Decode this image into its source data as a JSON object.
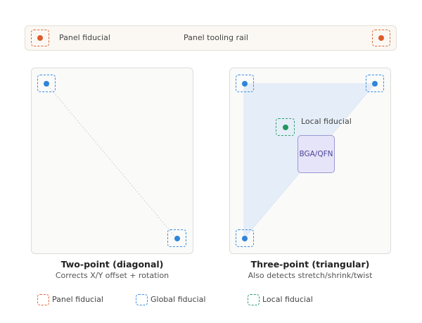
{
  "rail": {
    "left_label": "Panel fiducial",
    "center_label": "Panel tooling rail"
  },
  "two_point": {
    "title": "Two-point (diagonal)",
    "subtitle": "Corrects X/Y offset + rotation"
  },
  "three_point": {
    "title": "Three-point (triangular)",
    "subtitle": "Also detects stretch/shrink/twist",
    "local_label": "Local fiducial",
    "chip_label": "BGA/QFN"
  },
  "legend": {
    "panel": "Panel fiducial",
    "global": "Global fiducial",
    "local": "Local fiducial"
  },
  "colors": {
    "panel_fiducial": "#e05a2b",
    "global_fiducial": "#2f86d8",
    "local_fiducial": "#229661",
    "chip_fill": "#e6e4f8",
    "triangle_fill": "#e5eef8"
  }
}
